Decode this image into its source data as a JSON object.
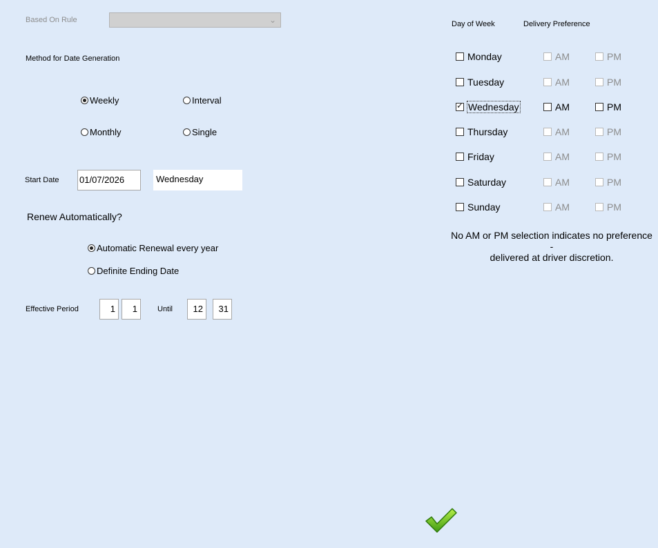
{
  "rule": {
    "label": "Based On Rule",
    "value": ""
  },
  "method": {
    "label": "Method for Date Generation",
    "options": [
      "Weekly",
      "Interval",
      "Monthly",
      "Single"
    ],
    "selected": "Weekly"
  },
  "start": {
    "label": "Start Date",
    "date": "01/07/2026",
    "weekday": "Wednesday"
  },
  "renew": {
    "label": "Renew Automatically?",
    "options": [
      "Automatic Renewal every year",
      "Definite Ending Date"
    ],
    "selected": "Automatic Renewal every year"
  },
  "period": {
    "label": "Effective Period",
    "from_month": "1",
    "from_day": "1",
    "until_label": "Until",
    "to_month": "12",
    "to_day": "31"
  },
  "schedule": {
    "day_header": "Day of Week",
    "pref_header": "Delivery Preference",
    "am": "AM",
    "pm": "PM",
    "days": [
      {
        "name": "Monday",
        "checked": false
      },
      {
        "name": "Tuesday",
        "checked": false
      },
      {
        "name": "Wednesday",
        "checked": true
      },
      {
        "name": "Thursday",
        "checked": false
      },
      {
        "name": "Friday",
        "checked": false
      },
      {
        "name": "Saturday",
        "checked": false
      },
      {
        "name": "Sunday",
        "checked": false
      }
    ],
    "note_line1": "No AM or PM selection indicates no preference -",
    "note_line2": "delivered at driver discretion."
  },
  "actions": {
    "confirm_icon": "green-checkmark-icon"
  }
}
